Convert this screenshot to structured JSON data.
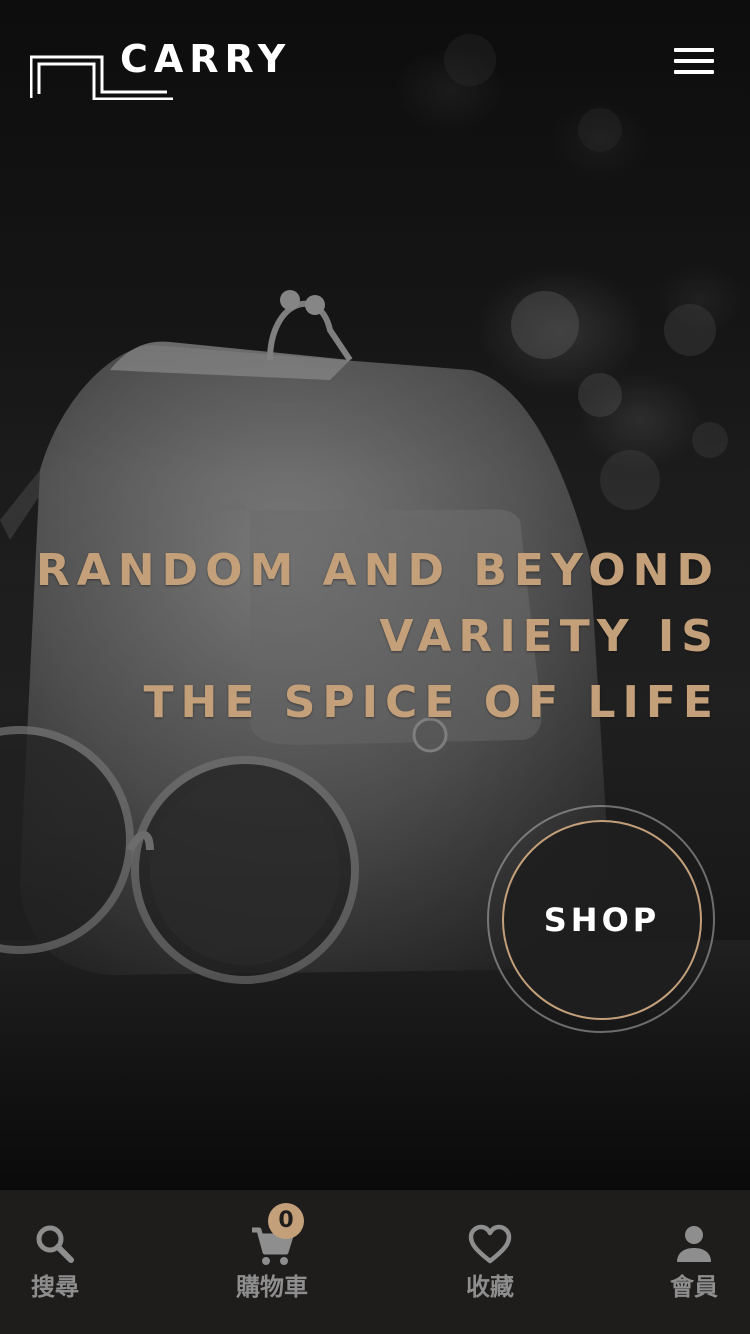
{
  "brand": {
    "name": "CARRY",
    "accent_color": "#c4a07a"
  },
  "header": {
    "menu_icon": "hamburger-menu-icon"
  },
  "hero": {
    "headline_lines": [
      "RANDOM AND BEYOND",
      "VARIETY IS",
      "THE SPICE OF LIFE"
    ],
    "shop_label": "SHOP"
  },
  "bottom_nav": {
    "items": [
      {
        "label": "搜尋",
        "icon": "search-icon"
      },
      {
        "label": "購物車",
        "icon": "cart-icon"
      },
      {
        "label": "收藏",
        "icon": "heart-icon"
      },
      {
        "label": "會員",
        "icon": "user-icon"
      }
    ],
    "cart_count": "0"
  }
}
